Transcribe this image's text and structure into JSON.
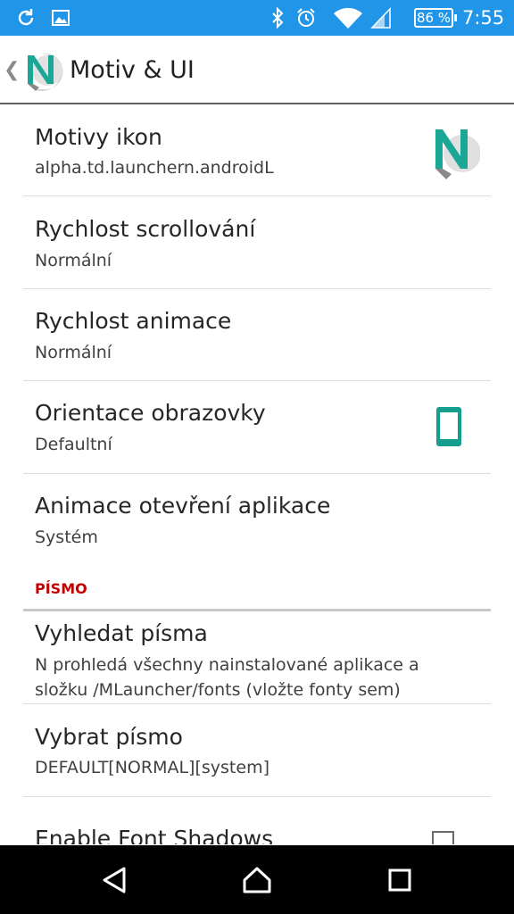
{
  "status_bar": {
    "battery": "86 %",
    "time": "7:55",
    "icons": [
      "sync-icon",
      "image-icon",
      "bluetooth-icon",
      "alarm-icon",
      "wifi-icon",
      "signal-icon"
    ]
  },
  "app_bar": {
    "title": "Motiv & UI",
    "logo": "n-launcher-logo"
  },
  "settings": [
    {
      "title": "Motivy ikon",
      "summary": "alpha.td.launchern.androidL",
      "icon": "n-launcher-logo"
    },
    {
      "title": "Rychlost scrollování",
      "summary": "Normální"
    },
    {
      "title": "Rychlost animace",
      "summary": "Normální"
    },
    {
      "title": "Orientace obrazovky",
      "summary": "Defaultní",
      "icon": "phone-portrait-icon"
    },
    {
      "title": "Animace otevření aplikace",
      "summary": "Systém"
    }
  ],
  "font_section": {
    "header": "PÍSMO",
    "items": [
      {
        "title": "Vyhledat písma",
        "summary_line1": "N prohledá všechny nainstalované aplikace a",
        "summary_line2": "složku /MLauncher/fonts (vložte fonty sem)"
      },
      {
        "title": "Vybrat písmo",
        "summary": "DEFAULT[NORMAL][system]"
      },
      {
        "title": "Enable Font Shadows",
        "checked": false
      }
    ]
  },
  "colors": {
    "status_bar": "#2196e8",
    "accent_red": "#c20000",
    "teal": "#139e8e"
  }
}
